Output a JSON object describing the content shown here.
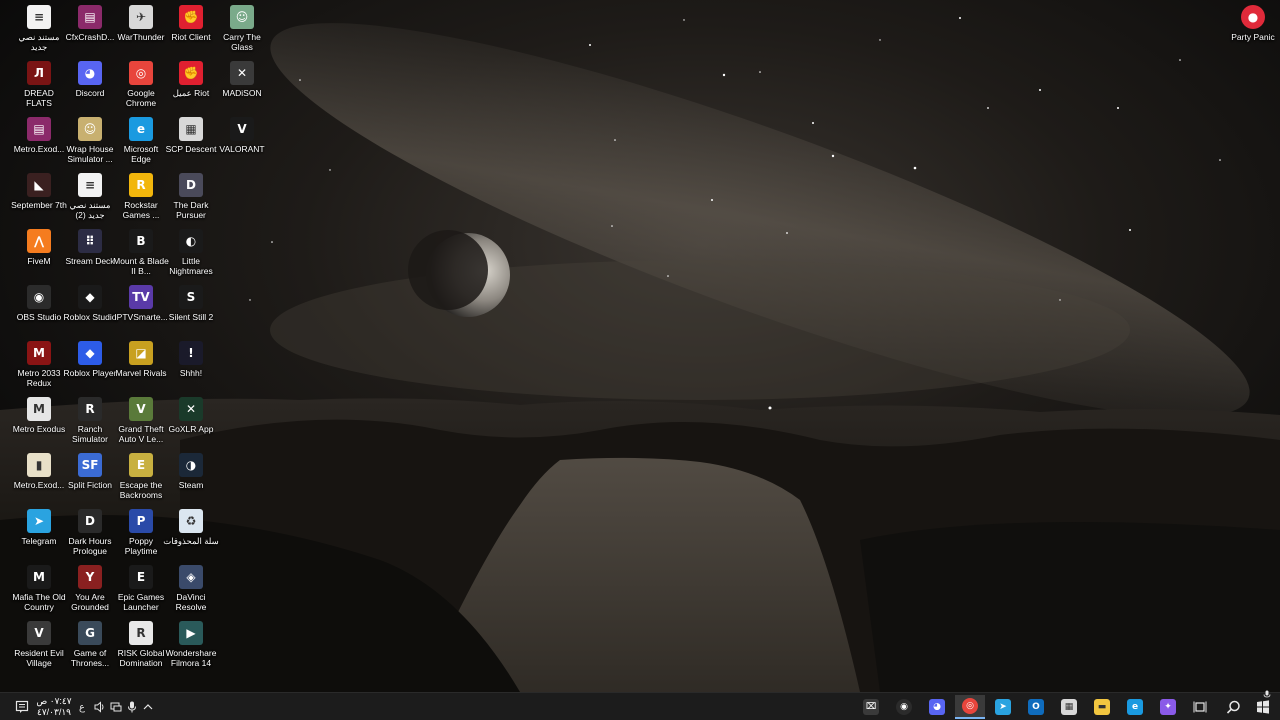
{
  "desktop": {
    "icons": [
      {
        "label": "مستند نصي جديد",
        "icon": "text-document-icon",
        "color": "#f2f2f2",
        "glyph": "≡"
      },
      {
        "label": "DREAD FLATS",
        "icon": "dread-flats-icon",
        "color": "#7a1414",
        "glyph": "Л"
      },
      {
        "label": "Metro.Exod...",
        "icon": "winrar-icon",
        "color": "#8b2a6a",
        "glyph": "▤"
      },
      {
        "label": "September 7th",
        "icon": "september-7th-icon",
        "color": "#3a2020",
        "glyph": "◣"
      },
      {
        "label": "FiveM",
        "icon": "fivem-icon",
        "color": "#f57c1f",
        "glyph": "⋀"
      },
      {
        "label": "OBS Studio",
        "icon": "obs-studio-icon",
        "color": "#2b2b2b",
        "glyph": "◉"
      },
      {
        "label": "Metro 2033 Redux",
        "icon": "metro-2033-icon",
        "color": "#8a1414",
        "glyph": "M"
      },
      {
        "label": "Metro Exodus",
        "icon": "metro-exodus-icon",
        "color": "#e6e6e6",
        "glyph": "M"
      },
      {
        "label": "Metro.Exod...",
        "icon": "document-icon",
        "color": "#e8e0c8",
        "glyph": "▮"
      },
      {
        "label": "Telegram",
        "icon": "telegram-icon",
        "color": "#2aa3e0",
        "glyph": "➤"
      },
      {
        "label": "Mafia The Old Country",
        "icon": "mafia-icon",
        "color": "#1a1a1a",
        "glyph": "M"
      },
      {
        "label": "Resident Evil Village",
        "icon": "resident-evil-icon",
        "color": "#3a3a3a",
        "glyph": "V"
      },
      {
        "label": "CfxCrashD...",
        "icon": "winrar-icon",
        "color": "#8b2a6a",
        "glyph": "▤"
      },
      {
        "label": "Discord",
        "icon": "discord-icon",
        "color": "#5865f2",
        "glyph": "◕"
      },
      {
        "label": "Wrap House Simulator ...",
        "icon": "wrap-house-icon",
        "color": "#c8b070",
        "glyph": "☺"
      },
      {
        "label": "مستند نصي جديد (2)",
        "icon": "text-document-icon",
        "color": "#f2f2f2",
        "glyph": "≡"
      },
      {
        "label": "Stream Deck",
        "icon": "stream-deck-icon",
        "color": "#2c2c44",
        "glyph": "⠿"
      },
      {
        "label": "Roblox Studio",
        "icon": "roblox-studio-icon",
        "color": "#1a1a1a",
        "glyph": "◆"
      },
      {
        "label": "Roblox Player",
        "icon": "roblox-player-icon",
        "color": "#2d5ce8",
        "glyph": "◆"
      },
      {
        "label": "Ranch Simulator",
        "icon": "ranch-simulator-icon",
        "color": "#2a2a2a",
        "glyph": "R"
      },
      {
        "label": "Split Fiction",
        "icon": "split-fiction-icon",
        "color": "#3b6bd4",
        "glyph": "SF"
      },
      {
        "label": "Dark Hours Prologue",
        "icon": "dark-hours-icon",
        "color": "#2a2a2a",
        "glyph": "D"
      },
      {
        "label": "You Are Grounded",
        "icon": "you-are-grounded-icon",
        "color": "#8a2020",
        "glyph": "Y"
      },
      {
        "label": "Game of Thrones...",
        "icon": "game-of-thrones-icon",
        "color": "#3a4a5a",
        "glyph": "G"
      },
      {
        "label": "WarThunder",
        "icon": "war-thunder-icon",
        "color": "#d8d8d8",
        "glyph": "✈"
      },
      {
        "label": "Google Chrome",
        "icon": "chrome-icon",
        "color": "#e8453c",
        "glyph": "◎"
      },
      {
        "label": "Microsoft Edge",
        "icon": "edge-icon",
        "color": "#1a9ae0",
        "glyph": "e"
      },
      {
        "label": "Rockstar Games ...",
        "icon": "rockstar-icon",
        "color": "#f2b60c",
        "glyph": "R"
      },
      {
        "label": "Mount & Blade II B...",
        "icon": "mount-blade-icon",
        "color": "#1a1a1a",
        "glyph": "B"
      },
      {
        "label": "IPTVSmarte...",
        "icon": "iptv-icon",
        "color": "#5a3aa8",
        "glyph": "TV"
      },
      {
        "label": "Marvel Rivals",
        "icon": "marvel-rivals-icon",
        "color": "#c8a020",
        "glyph": "◪"
      },
      {
        "label": "Grand Theft Auto V Le...",
        "icon": "gta-v-icon",
        "color": "#5a7a3a",
        "glyph": "V"
      },
      {
        "label": "Escape the Backrooms",
        "icon": "escape-backrooms-icon",
        "color": "#c8b040",
        "glyph": "E"
      },
      {
        "label": "Poppy Playtime",
        "icon": "poppy-playtime-icon",
        "color": "#2a4aa8",
        "glyph": "P"
      },
      {
        "label": "Epic Games Launcher",
        "icon": "epic-games-icon",
        "color": "#1a1a1a",
        "glyph": "E"
      },
      {
        "label": "RISK Global Domination",
        "icon": "risk-icon",
        "color": "#e8e8e8",
        "glyph": "R"
      },
      {
        "label": "Riot Client",
        "icon": "riot-client-icon",
        "color": "#e02030",
        "glyph": "✊"
      },
      {
        "label": "عميل Riot",
        "icon": "riot-client-icon",
        "color": "#e02030",
        "glyph": "✊"
      },
      {
        "label": "SCP Descent",
        "icon": "scp-descent-icon",
        "color": "#d8d8d8",
        "glyph": "▦"
      },
      {
        "label": "The Dark Pursuer",
        "icon": "dark-pursuer-icon",
        "color": "#4a4a5a",
        "glyph": "D"
      },
      {
        "label": "Little Nightmares",
        "icon": "little-nightmares-icon",
        "color": "#1a1a1a",
        "glyph": "◐"
      },
      {
        "label": "Silent Still 2",
        "icon": "silent-still-icon",
        "color": "#1a1a1a",
        "glyph": "S"
      },
      {
        "label": "Shhh!",
        "icon": "shhh-icon",
        "color": "#1a1a2a",
        "glyph": "!"
      },
      {
        "label": "GoXLR App",
        "icon": "goxlr-icon",
        "color": "#1a3a2a",
        "glyph": "✕"
      },
      {
        "label": "Steam",
        "icon": "steam-icon",
        "color": "#1b2838",
        "glyph": "◑"
      },
      {
        "label": "سلة المحذوفات",
        "icon": "recycle-bin-icon",
        "color": "#dbe6f0",
        "glyph": "♻"
      },
      {
        "label": "DaVinci Resolve",
        "icon": "davinci-resolve-icon",
        "color": "#3a4a6a",
        "glyph": "◈"
      },
      {
        "label": "Wondershare Filmora 14",
        "icon": "filmora-icon",
        "color": "#2a5a5a",
        "glyph": "▶"
      },
      {
        "label": "Carry The Glass",
        "icon": "carry-the-glass-icon",
        "color": "#7aaa8a",
        "glyph": "☺"
      },
      {
        "label": "MADiSON",
        "icon": "madison-icon",
        "color": "#3a3a3a",
        "glyph": "✕"
      },
      {
        "label": "VALORANT",
        "icon": "valorant-icon",
        "color": "#1a1a1a",
        "glyph": "V"
      }
    ],
    "party_panic": {
      "label": "Party Panic",
      "icon": "party-panic-icon",
      "color": "#e02a3a",
      "glyph": "●"
    }
  },
  "taskbar": {
    "clock_time": "٠٧:٤٧ ص",
    "clock_date": "٤٧/٠٣/١٩",
    "language": "ع",
    "apps": [
      {
        "name": "xbox-gamebar-icon",
        "color": "#3a3a3a",
        "glyph": "⌧"
      },
      {
        "name": "obs-studio-icon",
        "color": "#2b2b2b",
        "glyph": "◉"
      },
      {
        "name": "discord-icon",
        "color": "#5865f2",
        "glyph": "◕"
      },
      {
        "name": "chrome-icon",
        "color": "#e8453c",
        "glyph": "◎"
      },
      {
        "name": "telegram-icon",
        "color": "#2aa3e0",
        "glyph": "➤"
      },
      {
        "name": "outlook-icon",
        "color": "#0f6cbd",
        "glyph": "O"
      },
      {
        "name": "microsoft-store-icon",
        "color": "#d8d8d8",
        "glyph": "▦"
      },
      {
        "name": "file-explorer-icon",
        "color": "#f2c640",
        "glyph": "▬"
      },
      {
        "name": "edge-icon",
        "color": "#1a9ae0",
        "glyph": "e"
      },
      {
        "name": "copilot-icon",
        "color": "#8a5ae8",
        "glyph": "✦"
      }
    ]
  }
}
